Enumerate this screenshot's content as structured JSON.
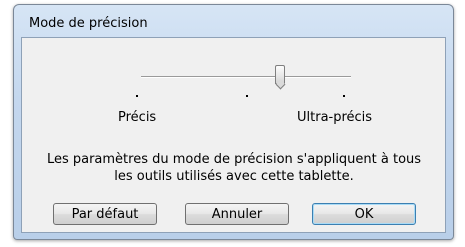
{
  "dialog": {
    "title": "Mode de précision",
    "slider": {
      "value_fraction": 0.65,
      "tick_count": 3,
      "min_label": "Précis",
      "max_label": "Ultra-précis"
    },
    "description_line1": "Les paramètres du mode de précision s'appliquent à tous",
    "description_line2": "les outils utilisés avec cette tablette.",
    "buttons": {
      "default_label": "Par défaut",
      "cancel_label": "Annuler",
      "ok_label": "OK"
    }
  }
}
